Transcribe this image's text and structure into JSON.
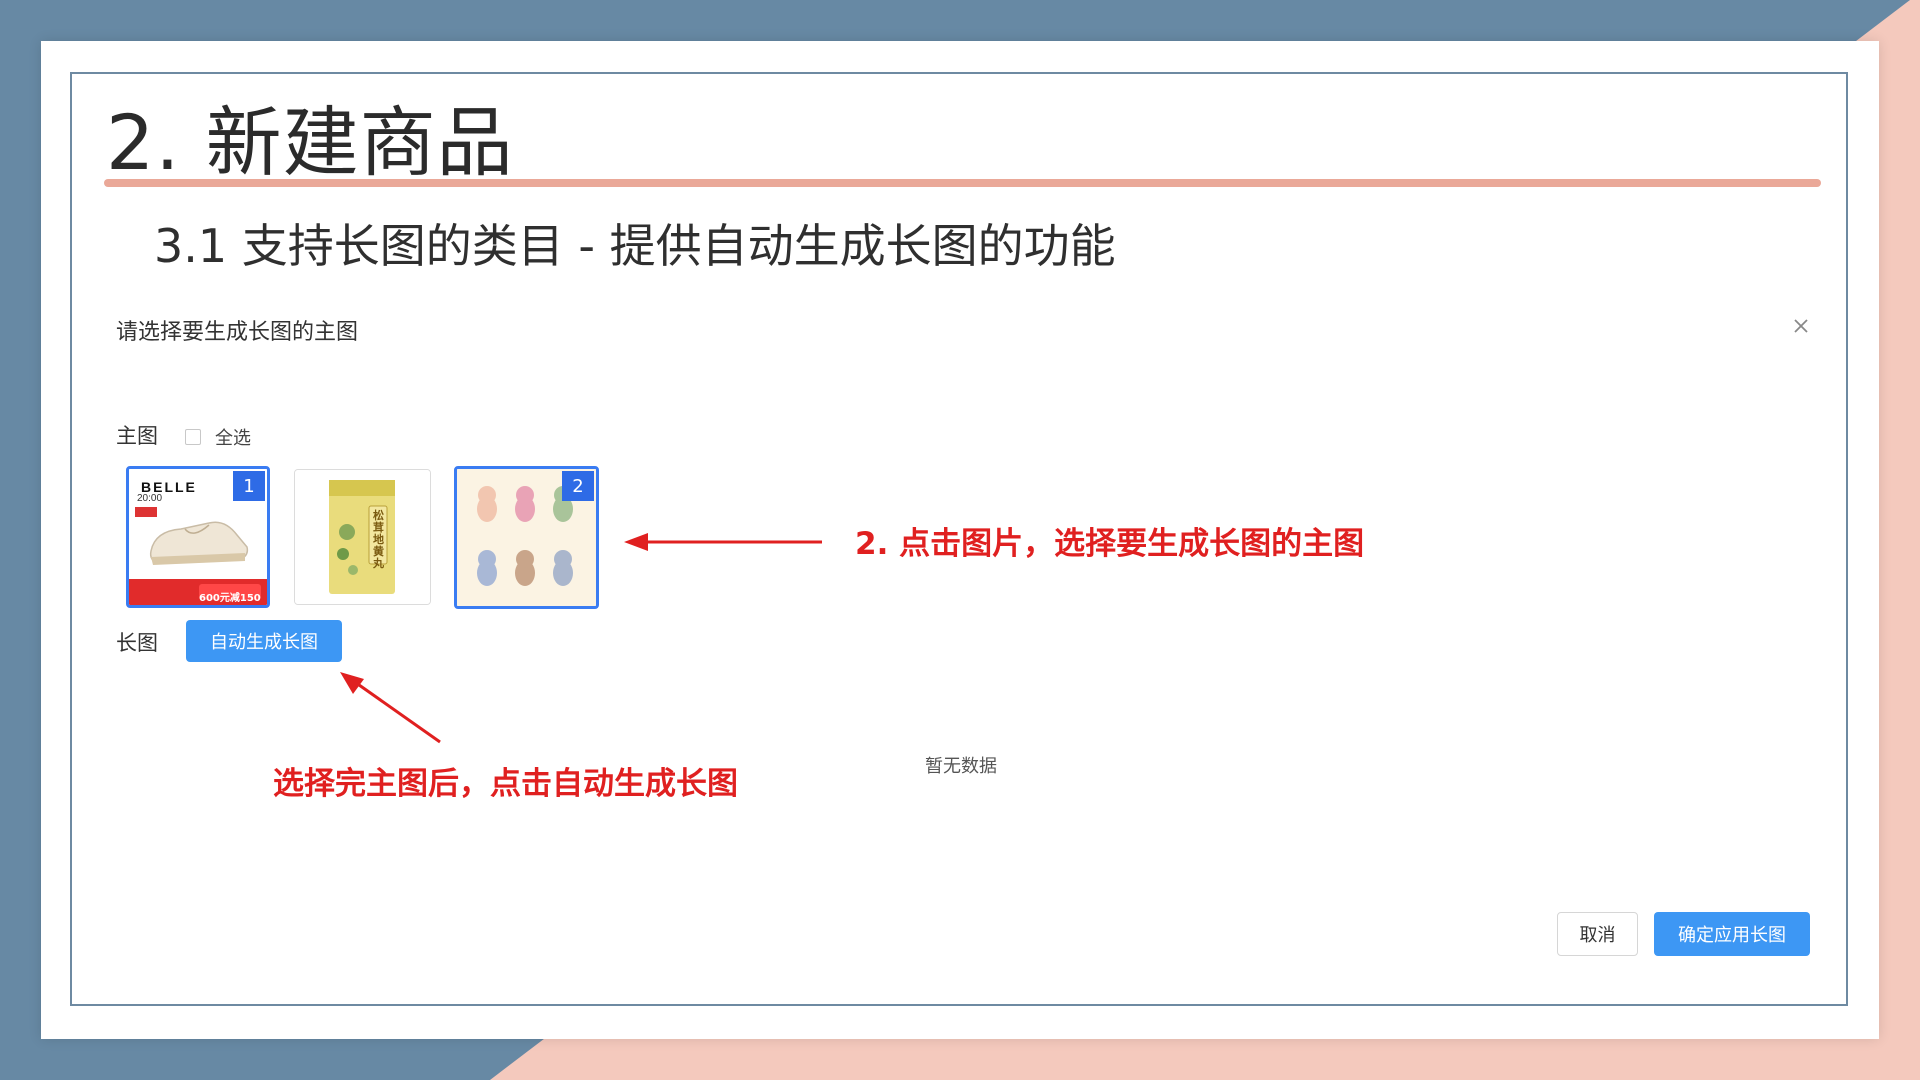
{
  "slide": {
    "title": "2. 新建商品",
    "subtitle": "3.1 支持长图的类目 - 提供自动生成长图的功能"
  },
  "dialog": {
    "title": "请选择要生成长图的主图",
    "close_icon": "close-icon",
    "main_images_label": "主图",
    "select_all_label": "全选",
    "select_all_checked": false,
    "images": [
      {
        "name": "belle-shoe-image",
        "selected": true,
        "order": "1",
        "brand_text": "BELLE",
        "price_text": "600元减150"
      },
      {
        "name": "food-package-image",
        "selected": false,
        "order": "",
        "package_text": "松茸地黄丸"
      },
      {
        "name": "plush-keychain-image",
        "selected": true,
        "order": "2"
      }
    ],
    "long_image_label": "长图",
    "auto_generate_button": "自动生成长图",
    "empty_text": "暂无数据",
    "cancel_button": "取消",
    "confirm_button": "确定应用长图"
  },
  "annotations": {
    "click_image": "2. 点击图片，选择要生成长图的主图",
    "after_select": "选择完主图后，点击自动生成长图"
  },
  "colors": {
    "primary": "#3d97f4",
    "selected_border": "#3a7cf2",
    "badge": "#2e6be6",
    "annotation_red": "#e02020",
    "title_rule": "#eaa898"
  }
}
